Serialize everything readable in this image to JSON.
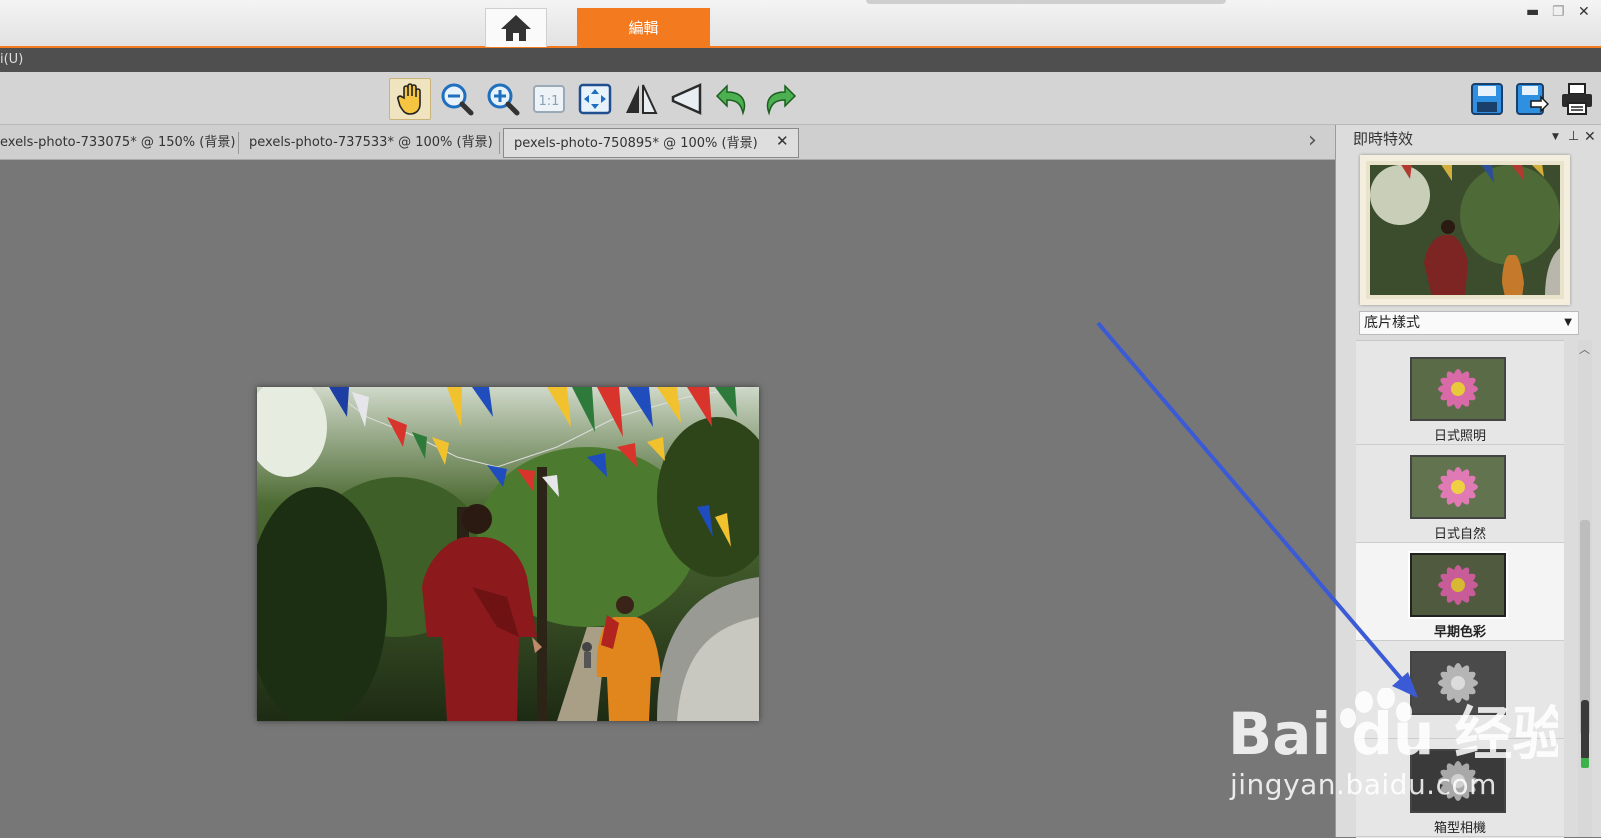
{
  "titlebar": {
    "edit_tab": "編輯",
    "window_buttons": {
      "minimize": "▬",
      "restore": "❐",
      "close": "✕"
    }
  },
  "menubar": {
    "partial_item": "i(U)"
  },
  "toolbar": {
    "tools": [
      "hand-tool",
      "zoom-out",
      "zoom-in",
      "actual-size",
      "fit-to-window",
      "flip-horizontal",
      "perspective",
      "undo",
      "redo"
    ],
    "actual_size_label": "1:1",
    "right_tools": [
      "save",
      "save-as",
      "print"
    ]
  },
  "doc_tabs": [
    {
      "label": "exels-photo-733075* @ 150% (背景)"
    },
    {
      "label": "pexels-photo-737533* @ 100% (背景)"
    },
    {
      "label": "pexels-photo-750895* @ 100% (背景)",
      "selected": true
    }
  ],
  "tab_close": "✕",
  "tab_scroll": "›",
  "panel": {
    "title": "即時特效",
    "dropdown_value": "底片樣式",
    "clipped_label": "",
    "effects": [
      {
        "label": "日式照明",
        "style": "color"
      },
      {
        "label": "日式自然",
        "style": "color"
      },
      {
        "label": "早期色彩",
        "style": "color",
        "selected": true
      },
      {
        "label": "",
        "style": "mono"
      },
      {
        "label": "箱型相機",
        "style": "mono"
      }
    ]
  },
  "watermark": {
    "brand": "Bai du 经验",
    "url": "jingyan.baidu.com"
  },
  "colors": {
    "accent": "#f47a20",
    "arrow": "#3b5bd6",
    "canvas": "#777777",
    "panel": "#dcdcdc"
  }
}
